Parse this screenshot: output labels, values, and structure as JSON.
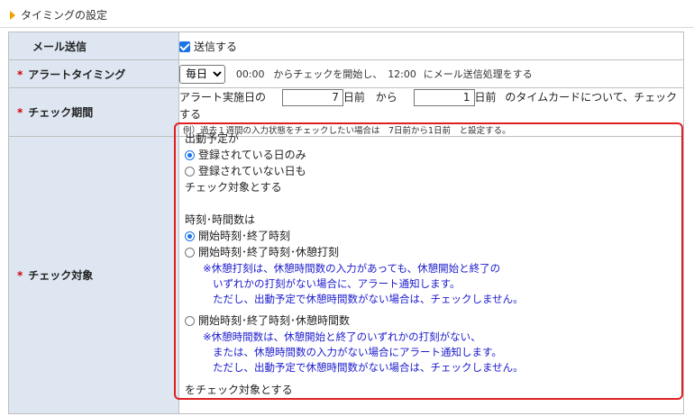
{
  "section": {
    "title": "タイミングの設定"
  },
  "rows": {
    "mail": {
      "label": "メール送信",
      "checkbox_label": "送信する",
      "checked": true
    },
    "alert": {
      "required_mark": "*",
      "label": "アラートタイミング",
      "select_value": "毎日",
      "time_start": "00:00",
      "text_mid": "からチェックを開始し、",
      "time_end": "12:00",
      "text_end": "にメール送信処理をする"
    },
    "period": {
      "required_mark": "*",
      "label": "チェック期間",
      "prefix": "アラート実施日の",
      "from_value": "7",
      "unit_from": "日前",
      "between": "から",
      "to_value": "1",
      "unit_to": "日前",
      "suffix": "のタイムカードについて、チェックする",
      "example": "例）過去１週間の入力状態をチェックしたい場合は　7日前から1日前　と設定する。"
    },
    "target": {
      "required_mark": "*",
      "label": "チェック対象",
      "schedule_heading": "出動予定が",
      "schedule_opt1": "登録されている日のみ",
      "schedule_opt2": "登録されていない日も",
      "schedule_tail": "チェック対象とする",
      "time_heading": "時刻･時間数は",
      "time_opt1": "開始時刻･終了時刻",
      "time_opt2": "開始時刻･終了時刻･休憩打刻",
      "note2_l1": "※休憩打刻は、休憩時間数の入力があっても、休憩開始と終了の",
      "note2_l2": "いずれかの打刻がない場合に、アラート通知します。",
      "note2_l3": "ただし、出動予定で休憩時間数がない場合は、チェックしません。",
      "time_opt3": "開始時刻･終了時刻･休憩時間数",
      "note3_l1": "※休憩時間数は、休憩開始と終了のいずれかの打刻がない、",
      "note3_l2": "または、休憩時間数の入力がない場合にアラート通知します。",
      "note3_l3": "ただし、出動予定で休憩時間数がない場合は、チェックしません。",
      "time_tail": "をチェック対象とする"
    }
  },
  "colors": {
    "label_bg": "#dde6f1",
    "required": "#d40000",
    "accent": "#1a73e8",
    "note": "#1a1acc",
    "highlight_border": "#e02020"
  }
}
